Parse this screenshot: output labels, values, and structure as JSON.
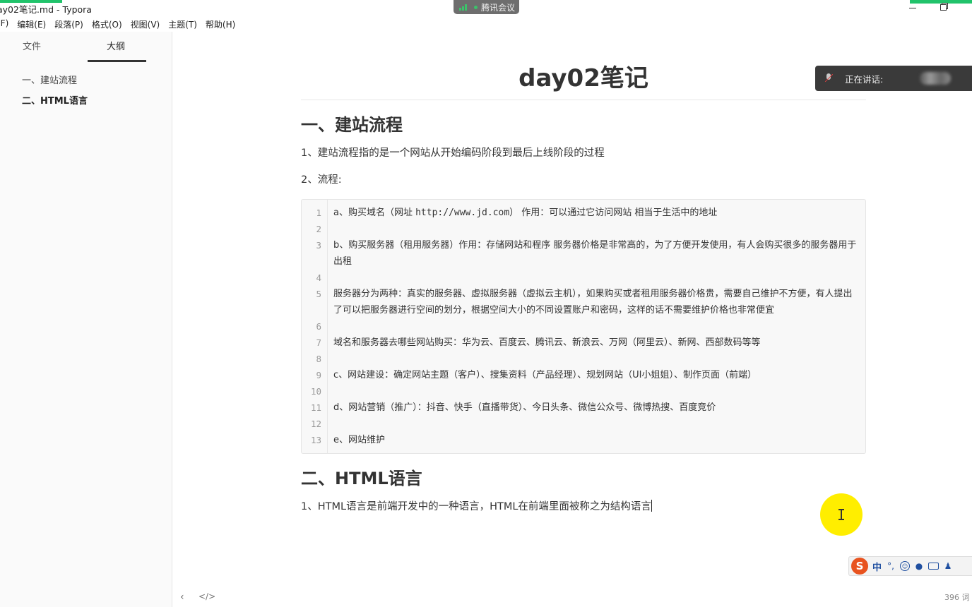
{
  "window": {
    "title": "ay02笔记.md - Typora"
  },
  "meeting": {
    "label": "腾讯会议"
  },
  "menu": {
    "items": [
      "(F)",
      "编辑(E)",
      "段落(P)",
      "格式(O)",
      "视图(V)",
      "主题(T)",
      "帮助(H)"
    ]
  },
  "sidebar": {
    "tabs": [
      "文件",
      "大纲"
    ],
    "active_tab": "大纲",
    "outline": [
      {
        "label": "一、建站流程",
        "bold": false
      },
      {
        "label": "二、HTML语言",
        "bold": true
      }
    ]
  },
  "document": {
    "title": "day02笔记",
    "section1": {
      "heading": "一、建站流程",
      "para1": "1、建站流程指的是一个网站从开始编码阶段到最后上线阶段的过程",
      "para2": "2、流程:"
    },
    "code_lines": [
      {
        "n": "1",
        "pre": "a、购买域名（网址 ",
        "url": "http://www.jd.com",
        "post": "） 作用：可以通过它访问网站 相当于生活中的地址"
      },
      {
        "n": "2",
        "pre": "",
        "url": "",
        "post": ""
      },
      {
        "n": "3",
        "pre": "b、购买服务器（租用服务器）作用：存储网站和程序 服务器价格是非常高的，为了方便开发使用，有人会购买很多的服务器用于出租",
        "url": "",
        "post": ""
      },
      {
        "n": "4",
        "pre": "",
        "url": "",
        "post": ""
      },
      {
        "n": "5",
        "pre": "服务器分为两种：真实的服务器、虚拟服务器（虚拟云主机），如果购买或者租用服务器价格贵，需要自己维护不方便，有人提出了可以把服务器进行空间的划分，根据空间大小的不同设置账户和密码，这样的话不需要维护价格也非常便宜",
        "url": "",
        "post": ""
      },
      {
        "n": "6",
        "pre": "",
        "url": "",
        "post": ""
      },
      {
        "n": "7",
        "pre": "域名和服务器去哪些网站购买：华为云、百度云、腾讯云、新浪云、万网（阿里云）、新网、西部数码等等",
        "url": "",
        "post": ""
      },
      {
        "n": "8",
        "pre": "",
        "url": "",
        "post": ""
      },
      {
        "n": "9",
        "pre": "c、网站建设：确定网站主题（客户）、搜集资料（产品经理）、规划网站（UI小姐姐）、制作页面（前端）",
        "url": "",
        "post": ""
      },
      {
        "n": "10",
        "pre": "",
        "url": "",
        "post": ""
      },
      {
        "n": "11",
        "pre": "d、网站营销（推广）：抖音、快手（直播带货）、今日头条、微信公众号、微博热搜、百度竞价",
        "url": "",
        "post": ""
      },
      {
        "n": "12",
        "pre": "",
        "url": "",
        "post": ""
      },
      {
        "n": "13",
        "pre": "e、网站维护",
        "url": "",
        "post": ""
      }
    ],
    "section2": {
      "heading": "二、HTML语言",
      "para1": "1、HTML语言是前端开发中的一种语言，HTML在前端里面被称之为结构语言"
    }
  },
  "overlay": {
    "speaking_label": "正在讲话:"
  },
  "ime": {
    "logo": "S",
    "mode": "中",
    "punct": "°,"
  },
  "footer": {
    "word_count": "396 词"
  },
  "colors": {
    "meeting_green": "#21c36b",
    "cursor_highlight": "#ffee00",
    "ime_logo": "#e8531f"
  }
}
